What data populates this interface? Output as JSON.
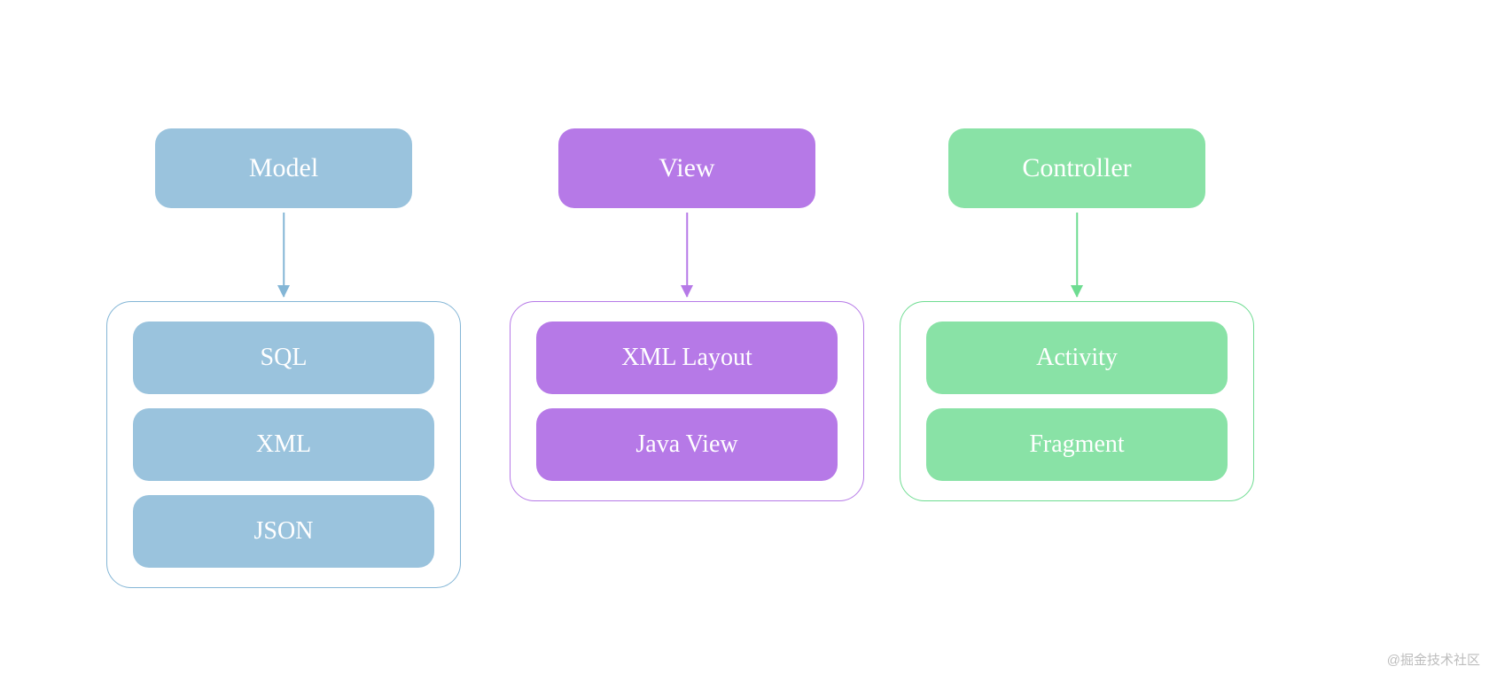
{
  "diagram": {
    "columns": [
      {
        "id": "model",
        "header": "Model",
        "color": "blue",
        "items": [
          "SQL",
          "XML",
          "JSON"
        ]
      },
      {
        "id": "view",
        "header": "View",
        "color": "purple",
        "items": [
          "XML Layout",
          "Java View"
        ]
      },
      {
        "id": "controller",
        "header": "Controller",
        "color": "green",
        "items": [
          "Activity",
          "Fragment"
        ]
      }
    ]
  },
  "watermark": "@掘金技术社区"
}
